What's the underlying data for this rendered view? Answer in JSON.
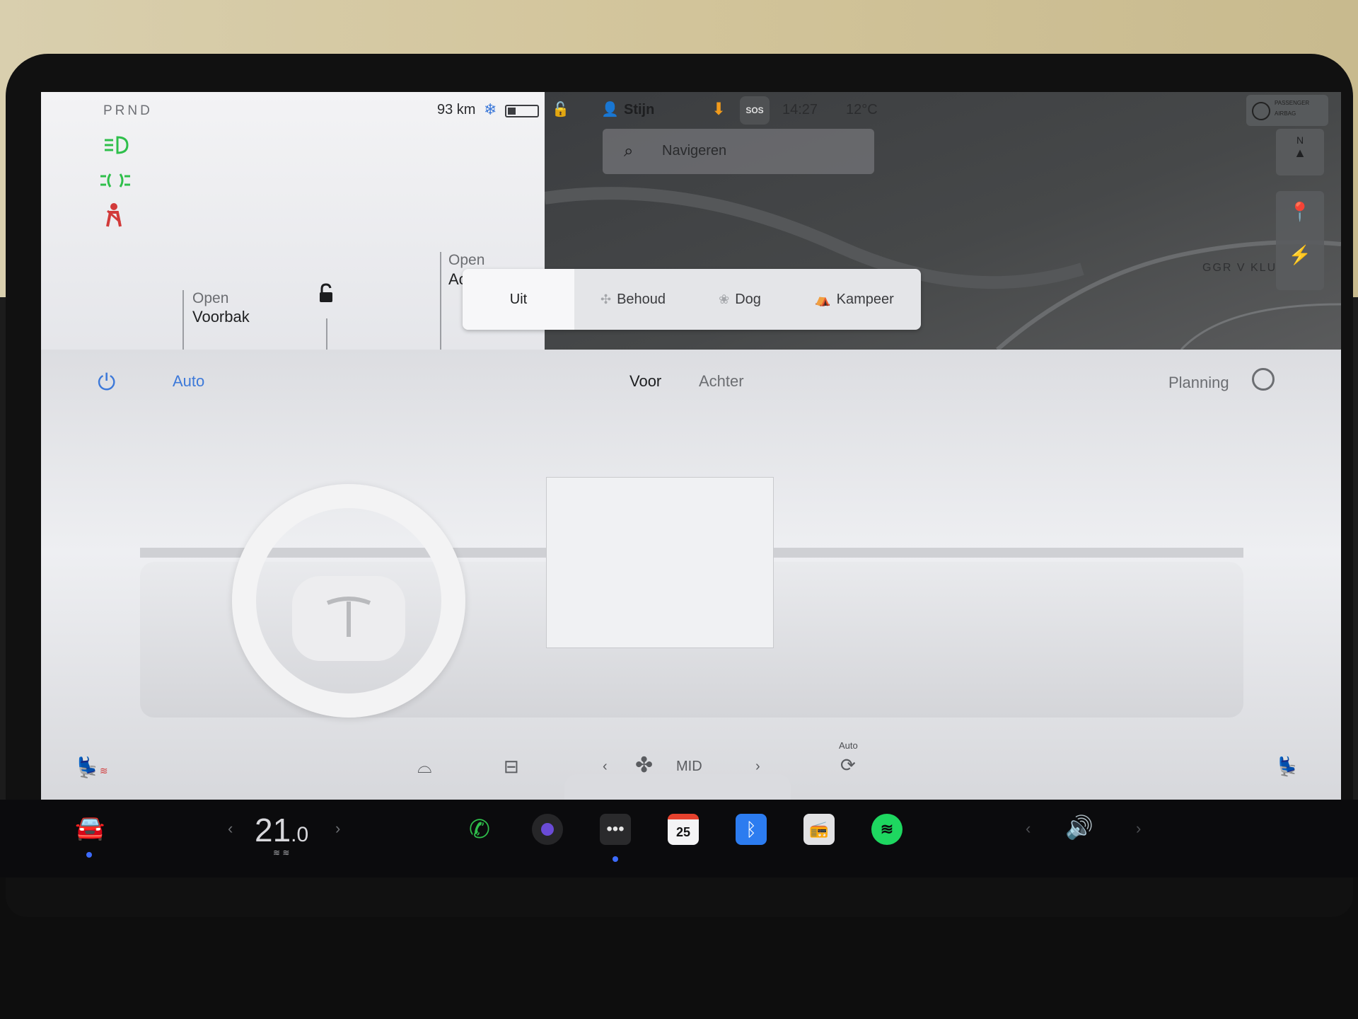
{
  "status": {
    "gear": "PRND",
    "range": "93 km",
    "profile": "Stijn",
    "sos": "SOS",
    "time": "14:27",
    "temperature": "12°C",
    "airbag_line1": "PASSENGER",
    "airbag_line2": "AIRBAG"
  },
  "car_panel": {
    "frunk_line1": "Open",
    "frunk_line2": "Voorbak",
    "trunk_line1": "Open",
    "trunk_line2": "Ac"
  },
  "map": {
    "search_placeholder": "Navigeren",
    "road_label": "GGR V KLU",
    "compass": "N"
  },
  "modes": {
    "items": [
      "Uit",
      "Behoud",
      "Dog",
      "Kampeer"
    ],
    "selected": "Uit"
  },
  "climate": {
    "auto_label": "Auto",
    "zone_front": "Voor",
    "zone_rear": "Achter",
    "schedule_label": "Planning",
    "fan_label": "MID",
    "recirc_label": "Auto"
  },
  "dock": {
    "temperature_whole": "21",
    "temperature_fraction": ".0",
    "calendar_day": "25"
  },
  "colors": {
    "accent": "#3d79d9",
    "ok_green": "#2fbf4b",
    "warning_red": "#d23a3a",
    "spotify": "#1ed760",
    "calendar_red": "#e5412d"
  }
}
